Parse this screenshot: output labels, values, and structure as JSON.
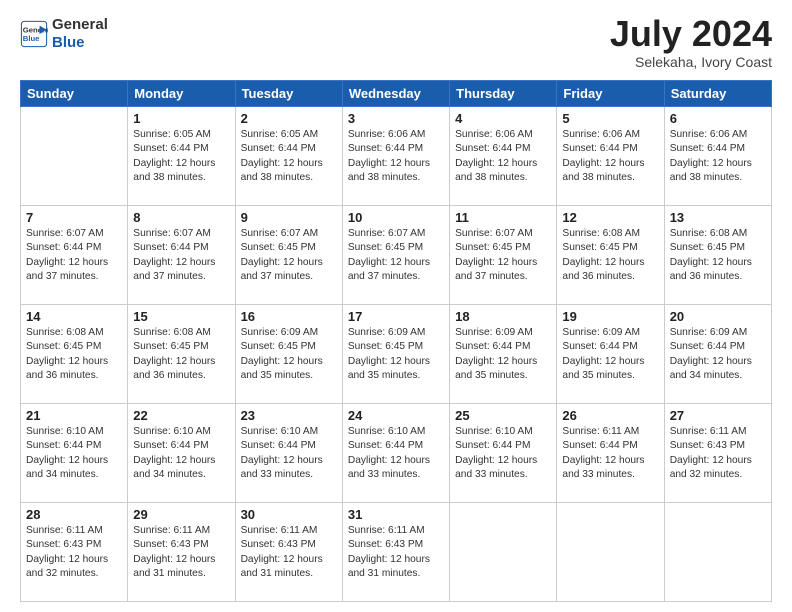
{
  "header": {
    "logo_line1": "General",
    "logo_line2": "Blue",
    "month_year": "July 2024",
    "location": "Selekaha, Ivory Coast"
  },
  "weekdays": [
    "Sunday",
    "Monday",
    "Tuesday",
    "Wednesday",
    "Thursday",
    "Friday",
    "Saturday"
  ],
  "weeks": [
    [
      {
        "day": "",
        "info": ""
      },
      {
        "day": "1",
        "info": "Sunrise: 6:05 AM\nSunset: 6:44 PM\nDaylight: 12 hours\nand 38 minutes."
      },
      {
        "day": "2",
        "info": "Sunrise: 6:05 AM\nSunset: 6:44 PM\nDaylight: 12 hours\nand 38 minutes."
      },
      {
        "day": "3",
        "info": "Sunrise: 6:06 AM\nSunset: 6:44 PM\nDaylight: 12 hours\nand 38 minutes."
      },
      {
        "day": "4",
        "info": "Sunrise: 6:06 AM\nSunset: 6:44 PM\nDaylight: 12 hours\nand 38 minutes."
      },
      {
        "day": "5",
        "info": "Sunrise: 6:06 AM\nSunset: 6:44 PM\nDaylight: 12 hours\nand 38 minutes."
      },
      {
        "day": "6",
        "info": "Sunrise: 6:06 AM\nSunset: 6:44 PM\nDaylight: 12 hours\nand 38 minutes."
      }
    ],
    [
      {
        "day": "7",
        "info": "Sunrise: 6:07 AM\nSunset: 6:44 PM\nDaylight: 12 hours\nand 37 minutes."
      },
      {
        "day": "8",
        "info": "Sunrise: 6:07 AM\nSunset: 6:44 PM\nDaylight: 12 hours\nand 37 minutes."
      },
      {
        "day": "9",
        "info": "Sunrise: 6:07 AM\nSunset: 6:45 PM\nDaylight: 12 hours\nand 37 minutes."
      },
      {
        "day": "10",
        "info": "Sunrise: 6:07 AM\nSunset: 6:45 PM\nDaylight: 12 hours\nand 37 minutes."
      },
      {
        "day": "11",
        "info": "Sunrise: 6:07 AM\nSunset: 6:45 PM\nDaylight: 12 hours\nand 37 minutes."
      },
      {
        "day": "12",
        "info": "Sunrise: 6:08 AM\nSunset: 6:45 PM\nDaylight: 12 hours\nand 36 minutes."
      },
      {
        "day": "13",
        "info": "Sunrise: 6:08 AM\nSunset: 6:45 PM\nDaylight: 12 hours\nand 36 minutes."
      }
    ],
    [
      {
        "day": "14",
        "info": "Sunrise: 6:08 AM\nSunset: 6:45 PM\nDaylight: 12 hours\nand 36 minutes."
      },
      {
        "day": "15",
        "info": "Sunrise: 6:08 AM\nSunset: 6:45 PM\nDaylight: 12 hours\nand 36 minutes."
      },
      {
        "day": "16",
        "info": "Sunrise: 6:09 AM\nSunset: 6:45 PM\nDaylight: 12 hours\nand 35 minutes."
      },
      {
        "day": "17",
        "info": "Sunrise: 6:09 AM\nSunset: 6:45 PM\nDaylight: 12 hours\nand 35 minutes."
      },
      {
        "day": "18",
        "info": "Sunrise: 6:09 AM\nSunset: 6:44 PM\nDaylight: 12 hours\nand 35 minutes."
      },
      {
        "day": "19",
        "info": "Sunrise: 6:09 AM\nSunset: 6:44 PM\nDaylight: 12 hours\nand 35 minutes."
      },
      {
        "day": "20",
        "info": "Sunrise: 6:09 AM\nSunset: 6:44 PM\nDaylight: 12 hours\nand 34 minutes."
      }
    ],
    [
      {
        "day": "21",
        "info": "Sunrise: 6:10 AM\nSunset: 6:44 PM\nDaylight: 12 hours\nand 34 minutes."
      },
      {
        "day": "22",
        "info": "Sunrise: 6:10 AM\nSunset: 6:44 PM\nDaylight: 12 hours\nand 34 minutes."
      },
      {
        "day": "23",
        "info": "Sunrise: 6:10 AM\nSunset: 6:44 PM\nDaylight: 12 hours\nand 33 minutes."
      },
      {
        "day": "24",
        "info": "Sunrise: 6:10 AM\nSunset: 6:44 PM\nDaylight: 12 hours\nand 33 minutes."
      },
      {
        "day": "25",
        "info": "Sunrise: 6:10 AM\nSunset: 6:44 PM\nDaylight: 12 hours\nand 33 minutes."
      },
      {
        "day": "26",
        "info": "Sunrise: 6:11 AM\nSunset: 6:44 PM\nDaylight: 12 hours\nand 33 minutes."
      },
      {
        "day": "27",
        "info": "Sunrise: 6:11 AM\nSunset: 6:43 PM\nDaylight: 12 hours\nand 32 minutes."
      }
    ],
    [
      {
        "day": "28",
        "info": "Sunrise: 6:11 AM\nSunset: 6:43 PM\nDaylight: 12 hours\nand 32 minutes."
      },
      {
        "day": "29",
        "info": "Sunrise: 6:11 AM\nSunset: 6:43 PM\nDaylight: 12 hours\nand 31 minutes."
      },
      {
        "day": "30",
        "info": "Sunrise: 6:11 AM\nSunset: 6:43 PM\nDaylight: 12 hours\nand 31 minutes."
      },
      {
        "day": "31",
        "info": "Sunrise: 6:11 AM\nSunset: 6:43 PM\nDaylight: 12 hours\nand 31 minutes."
      },
      {
        "day": "",
        "info": ""
      },
      {
        "day": "",
        "info": ""
      },
      {
        "day": "",
        "info": ""
      }
    ]
  ]
}
